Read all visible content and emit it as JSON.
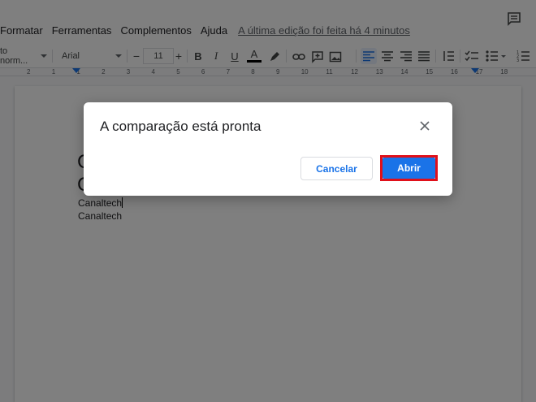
{
  "menubar": {
    "items": [
      "Formatar",
      "Ferramentas",
      "Complementos",
      "Ajuda"
    ],
    "last_edit": "A última edição foi feita há 4 minutos"
  },
  "toolbar": {
    "style": "to norm...",
    "font": "Arial",
    "font_size": "11",
    "minus": "−",
    "plus": "+",
    "bold": "B",
    "italic": "I",
    "underline": "U",
    "text_color": "A"
  },
  "ruler": {
    "ticks": [
      "2",
      "1",
      "1",
      "2",
      "3",
      "4",
      "5",
      "6",
      "7",
      "8",
      "9",
      "10",
      "11",
      "12",
      "13",
      "14",
      "15",
      "16",
      "17",
      "18"
    ]
  },
  "document": {
    "big_letters": [
      "C",
      "C"
    ],
    "lines": [
      "Canaltech",
      "Canaltech"
    ]
  },
  "dialog": {
    "title": "A comparação está pronta",
    "cancel_label": "Cancelar",
    "open_label": "Abrir"
  },
  "colors": {
    "accent": "#1a73e8",
    "highlight_frame": "#e0101a"
  }
}
